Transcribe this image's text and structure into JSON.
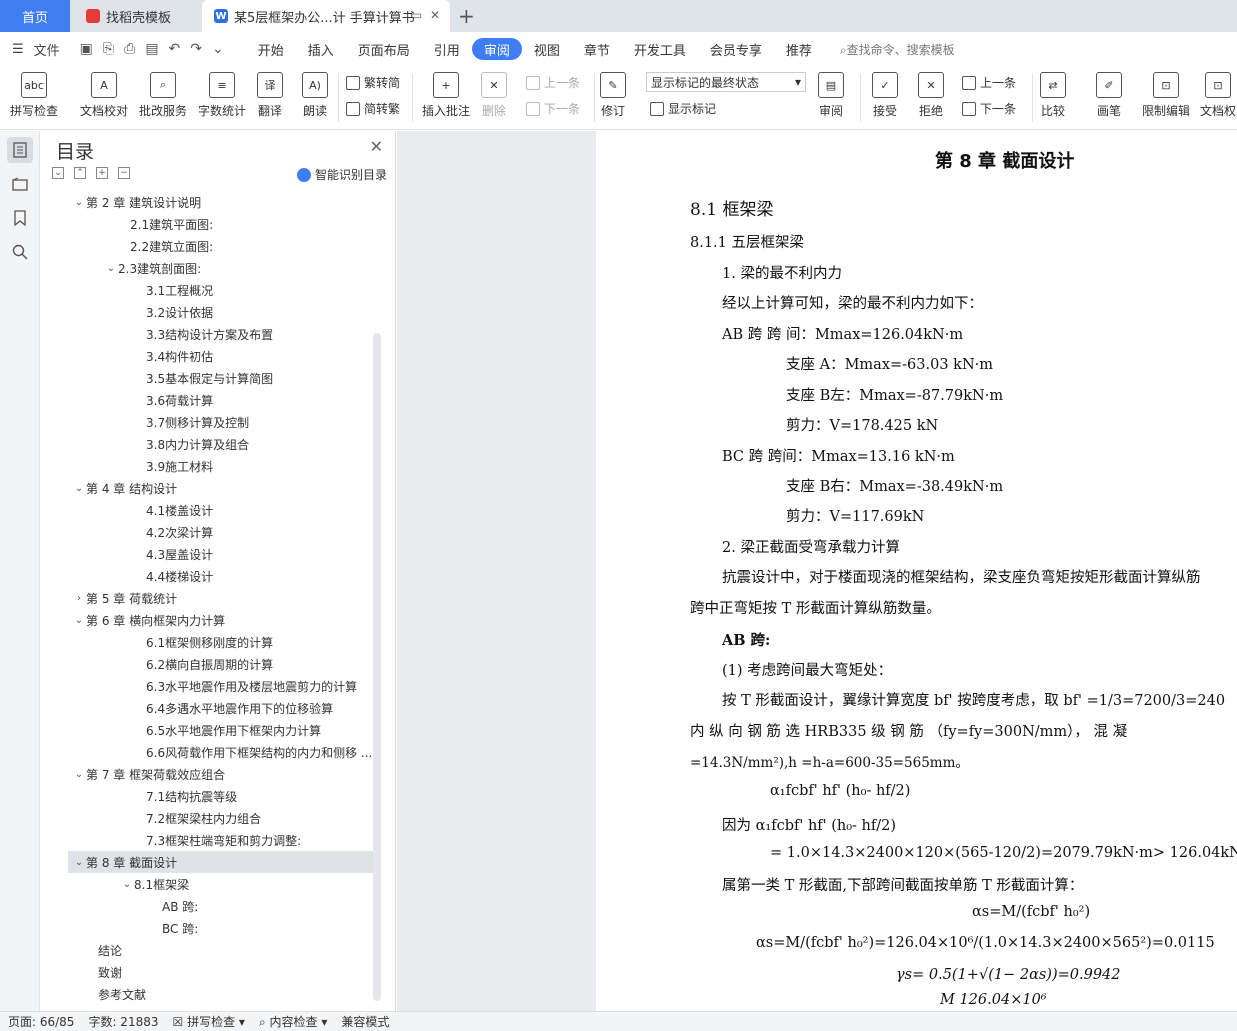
{
  "tabs": {
    "home": "首页",
    "doc1": "找稻壳模板",
    "doc2": "某5层框架办公...计 手算计算书"
  },
  "menubar": {
    "file": "文件",
    "tabs": [
      "开始",
      "插入",
      "页面布局",
      "引用",
      "审阅",
      "视图",
      "章节",
      "开发工具",
      "会员专享",
      "推荐"
    ],
    "active_tab": "审阅",
    "search": "查找命令、搜索模板"
  },
  "toolbar": {
    "spell": "拼写检查",
    "doc_check": "文档校对",
    "batch": "批改服务",
    "word_count": "字数统计",
    "translate": "翻译",
    "read": "朗读",
    "trad_to_simp": "繁转简",
    "simp_to_trad": "简转繁",
    "insert_comment": "插入批注",
    "delete": "删除",
    "prev": "上一条",
    "next": "下一条",
    "revise": "修订",
    "markup_state": "显示标记的最终状态",
    "show_markup": "显示标记",
    "review": "审阅",
    "accept": "接受",
    "reject": "拒绝",
    "prev2": "上一条",
    "next2": "下一条",
    "compare": "比较",
    "pen": "画笔",
    "restrict": "限制编辑",
    "doc_perm": "文档权"
  },
  "toc": {
    "title": "目录",
    "smart": "智能识别目录",
    "items": [
      {
        "label": "第 2 章 建筑设计说明",
        "level": 0,
        "arrow": "v"
      },
      {
        "label": "2.1建筑平面图:",
        "level": 2,
        "arrow": ""
      },
      {
        "label": "2.2建筑立面图:",
        "level": 2,
        "arrow": ""
      },
      {
        "label": "2.3建筑剖面图:",
        "level": 1,
        "arrow": "v"
      },
      {
        "label": "3.1工程概况",
        "level": 3,
        "arrow": ""
      },
      {
        "label": "3.2设计依据",
        "level": 3,
        "arrow": ""
      },
      {
        "label": "3.3结构设计方案及布置",
        "level": 3,
        "arrow": ""
      },
      {
        "label": "3.4构件初估",
        "level": 3,
        "arrow": ""
      },
      {
        "label": "3.5基本假定与计算简图",
        "level": 3,
        "arrow": ""
      },
      {
        "label": "3.6荷载计算",
        "level": 3,
        "arrow": ""
      },
      {
        "label": "3.7侧移计算及控制",
        "level": 3,
        "arrow": ""
      },
      {
        "label": "3.8内力计算及组合",
        "level": 3,
        "arrow": ""
      },
      {
        "label": "3.9施工材料",
        "level": 3,
        "arrow": ""
      },
      {
        "label": "第 4 章 结构设计",
        "level": 0,
        "arrow": "v"
      },
      {
        "label": "4.1楼盖设计",
        "level": 3,
        "arrow": ""
      },
      {
        "label": "4.2次梁计算",
        "level": 3,
        "arrow": ""
      },
      {
        "label": "4.3屋盖设计",
        "level": 3,
        "arrow": ""
      },
      {
        "label": "4.4楼梯设计",
        "level": 3,
        "arrow": ""
      },
      {
        "label": "第 5 章 荷载统计",
        "level": 0,
        "arrow": ">"
      },
      {
        "label": "第 6 章 横向框架内力计算",
        "level": 0,
        "arrow": "v"
      },
      {
        "label": "6.1框架侧移刚度的计算",
        "level": 3,
        "arrow": ""
      },
      {
        "label": "6.2横向自振周期的计算",
        "level": 3,
        "arrow": ""
      },
      {
        "label": "6.3水平地震作用及楼层地震剪力的计算",
        "level": 3,
        "arrow": ""
      },
      {
        "label": "6.4多遇水平地震作用下的位移验算",
        "level": 3,
        "arrow": ""
      },
      {
        "label": "6.5水平地震作用下框架内力计算",
        "level": 3,
        "arrow": ""
      },
      {
        "label": "6.6风荷载作用下框架结构的内力和侧移 ...",
        "level": 3,
        "arrow": ""
      },
      {
        "label": "第 7 章 框架荷载效应组合",
        "level": 0,
        "arrow": "v"
      },
      {
        "label": "7.1结构抗震等级",
        "level": 3,
        "arrow": ""
      },
      {
        "label": "7.2框架梁柱内力组合",
        "level": 3,
        "arrow": ""
      },
      {
        "label": "7.3框架柱端弯矩和剪力调整:",
        "level": 3,
        "arrow": ""
      },
      {
        "label": "第 8 章 截面设计",
        "level": 0,
        "arrow": "v",
        "selected": true
      },
      {
        "label": "8.1框架梁",
        "level": 2.5,
        "arrow": "v"
      },
      {
        "label": "AB 跨:",
        "level": 4,
        "arrow": ""
      },
      {
        "label": "BC 跨:",
        "level": 4,
        "arrow": ""
      },
      {
        "label": "结论",
        "level": -1,
        "arrow": ""
      },
      {
        "label": "致谢",
        "level": -1,
        "arrow": ""
      },
      {
        "label": "参考文献",
        "level": -1,
        "arrow": ""
      }
    ]
  },
  "document": {
    "chapter": "第 8 章  截面设计",
    "sec": "8.1  框架梁",
    "subsec": "8.1.1 五层框架梁",
    "p1": "1. 梁的最不利内力",
    "p2": "经以上计算可知，梁的最不利内力如下：",
    "ab1": "AB 跨   跨 间：Mmax=126.04kN·m",
    "ab2": "支座 A：Mmax=-63.03 kN·m",
    "ab3": "支座 B左：Mmax=-87.79kN·m",
    "ab4": "剪力：V=178.425 kN",
    "bc1": "BC 跨   跨间：Mmax=13.16 kN·m",
    "bc2": "支座 B右：Mmax=-38.49kN·m",
    "bc3": "剪力：V=117.69kN",
    "p3": "2. 梁正截面受弯承载力计算",
    "p4": "抗震设计中，对于楼面现浇的框架结构，梁支座负弯矩按矩形截面计算纵筋",
    "p5": "跨中正弯矩按 T 形截面计算纵筋数量。",
    "p6": "AB 跨:",
    "p7": "(1) 考虑跨间最大弯矩处：",
    "p8": "按 T 形截面设计，翼缘计算宽度 bf' 按跨度考虑，取 bf' =1/3=7200/3=240",
    "p9": "内 纵 向  钢  筋  选  HRB335  级  钢  筋 （fy=fy=300N/mm），  混  凝",
    "p10": "=14.3N/mm²),h =h-a=600-35=565mm。",
    "f1": "α₁fcbf' hf' (h₀- hf/2)",
    "f2": "因为   α₁fcbf' hf' (h₀- hf/2)",
    "f3": "= 1.0×14.3×2400×120×(565-120/2)=2079.79kN·m> 126.04kN",
    "p11": "属第一类 T 形截面,下部跨间截面按单筋 T 形截面计算：",
    "f4": "αs=M/(fcbf' h₀²)",
    "f5": "αs=M/(fcbf' h₀²)=126.04×10⁶/(1.0×14.3×2400×565²)=0.0115",
    "f6": "γs= 0.5(1+√(1− 2αs))=0.9942",
    "f7": "M          126.04×10⁶"
  },
  "status": {
    "page": "页面: 66/85",
    "words": "字数: 21883",
    "spell": "拼写检查",
    "content": "内容检查",
    "compat": "兼容模式"
  }
}
